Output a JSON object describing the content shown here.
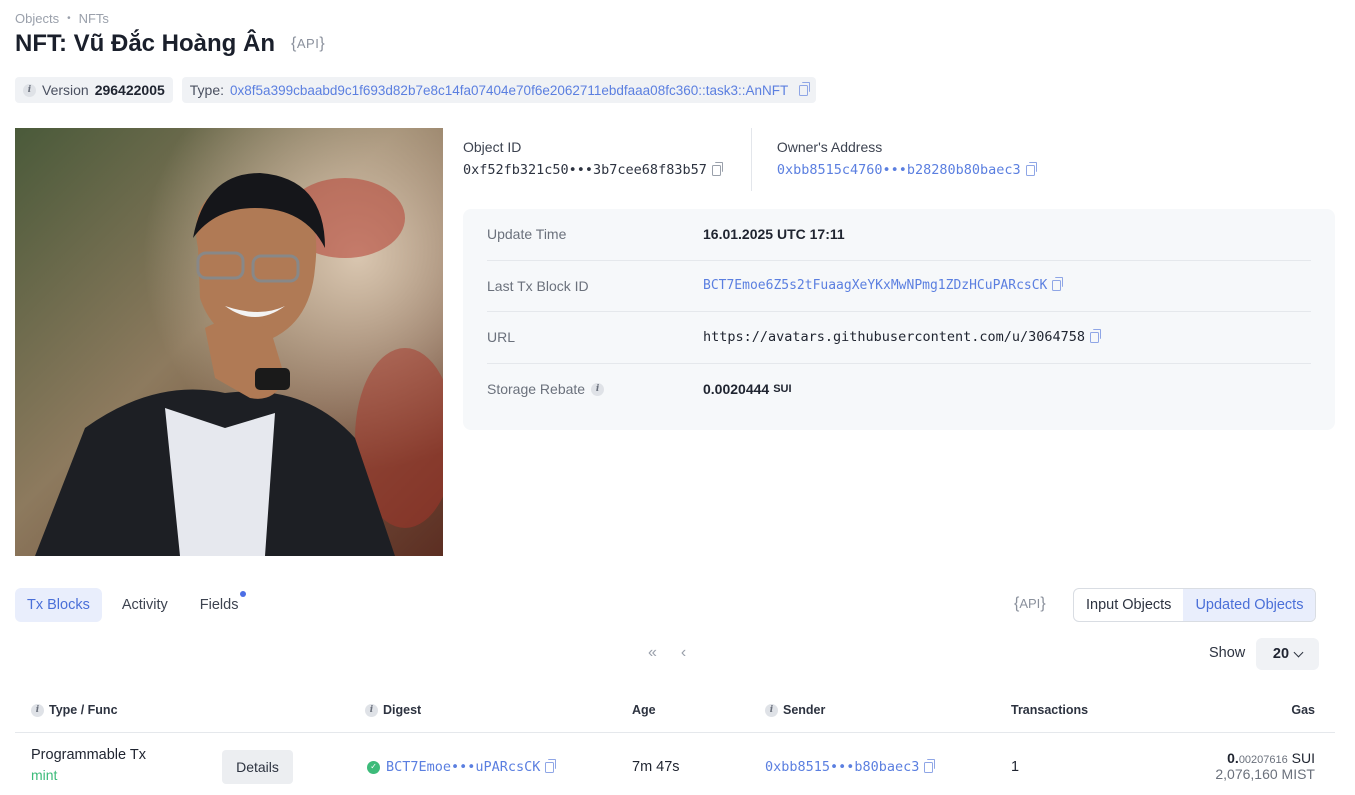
{
  "breadcrumb": {
    "first": "Objects",
    "sep": "•",
    "second": "NFTs"
  },
  "title": "NFT: Vũ Đắc Hoàng Ân",
  "api_badge": "API",
  "version": {
    "label": "Version",
    "value": "296422005"
  },
  "type": {
    "label": "Type:",
    "value": "0x8f5a399cbaabd9c1f693d82b7e8c14fa07404e70f6e2062711ebdfaaa08fc360::task3::AnNFT"
  },
  "object_id": {
    "label": "Object ID",
    "value": "0xf52fb321c50•••3b7cee68f83b57"
  },
  "owner": {
    "label": "Owner's Address",
    "value": "0xbb8515c4760•••b28280b80baec3"
  },
  "details": {
    "update_time": {
      "label": "Update Time",
      "value": "16.01.2025 UTC 17:11"
    },
    "last_tx": {
      "label": "Last Tx Block ID",
      "value": "BCT7Emoe6Z5s2tFuaagXeYKxMwNPmg1ZDzHCuPARcsCK"
    },
    "url": {
      "label": "URL",
      "value": "https://avatars.githubusercontent.com/u/3064758"
    },
    "storage_rebate": {
      "label": "Storage Rebate",
      "value": "0.0020444",
      "unit": "SUI"
    }
  },
  "tabs": [
    "Tx Blocks",
    "Activity",
    "Fields"
  ],
  "filter": {
    "input": "Input Objects",
    "updated": "Updated Objects"
  },
  "pager": {
    "first": "«",
    "prev": "‹"
  },
  "show": {
    "label": "Show",
    "value": "20"
  },
  "table": {
    "headers": {
      "type": "Type / Func",
      "digest": "Digest",
      "age": "Age",
      "sender": "Sender",
      "transactions": "Transactions",
      "gas": "Gas"
    },
    "rows": [
      {
        "type": "Programmable Tx",
        "func": "mint",
        "details": "Details",
        "digest": "BCT7Emoe•••uPARcsCK",
        "age": "7m 47s",
        "sender": "0xbb8515•••b80baec3",
        "transactions": "1",
        "gas_int": "0.",
        "gas_dec": "00207616",
        "gas_unit": "SUI",
        "gas_mist": "2,076,160 MIST"
      }
    ]
  },
  "colors": {
    "accent": "#5b7fe0",
    "success": "#3dbb7a"
  }
}
